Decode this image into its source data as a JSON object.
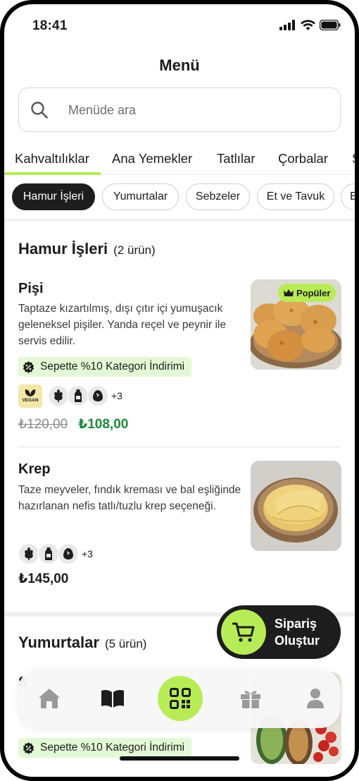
{
  "status_bar": {
    "time": "18:41"
  },
  "header": {
    "title": "Menü"
  },
  "search": {
    "placeholder": "Menüde ara"
  },
  "categories": {
    "tabs": [
      {
        "label": "Kahvaltılıklar",
        "active": true
      },
      {
        "label": "Ana Yemekler"
      },
      {
        "label": "Tatlılar"
      },
      {
        "label": "Çorbalar"
      },
      {
        "label": "S"
      }
    ]
  },
  "subcategories": {
    "chips": [
      {
        "label": "Hamur İşleri",
        "active": true
      },
      {
        "label": "Yumurtalar"
      },
      {
        "label": "Sebzeler"
      },
      {
        "label": "Et ve Tavuk"
      },
      {
        "label": "E"
      }
    ]
  },
  "sections": [
    {
      "title": "Hamur İşleri",
      "count": "(2 ürün)",
      "items": [
        {
          "name": "Pişi",
          "description": "Taptaze kızartılmış, dışı çıtır içi yumuşacık geleneksel pişiler. Yanda reçel ve peynir ile servis edilir.",
          "badge": "Popüler",
          "discount": "Sepette %10 Kategori İndirimi",
          "vegan_label": "VEGAN",
          "tags_more": "+3",
          "price_old": "₺120,00",
          "price_new": "₺108,00"
        },
        {
          "name": "Krep",
          "description": "Taze meyveler, fındık kreması ve bal eşliğinde hazırlanan nefis tatlı/tuzlu krep seçeneği.",
          "tags_more": "+3",
          "price": "₺145,00"
        }
      ]
    },
    {
      "title": "Yumurtalar",
      "count": "(5 ürün)",
      "items": [
        {
          "discount": "Sepette %10 Kategori İndirimi"
        }
      ]
    }
  ],
  "order_button": {
    "label": "Sipariş Oluştur"
  },
  "bottom_nav": {
    "items": [
      {
        "icon": "home-icon"
      },
      {
        "icon": "book-icon"
      },
      {
        "icon": "qr-code-icon",
        "active": true
      },
      {
        "icon": "gift-icon"
      },
      {
        "icon": "profile-icon"
      }
    ]
  },
  "colors": {
    "accent": "#b8ec57",
    "price_green": "#1e8a3c",
    "discount_bg": "#e3f9d6",
    "dark": "#1d1d1d"
  }
}
